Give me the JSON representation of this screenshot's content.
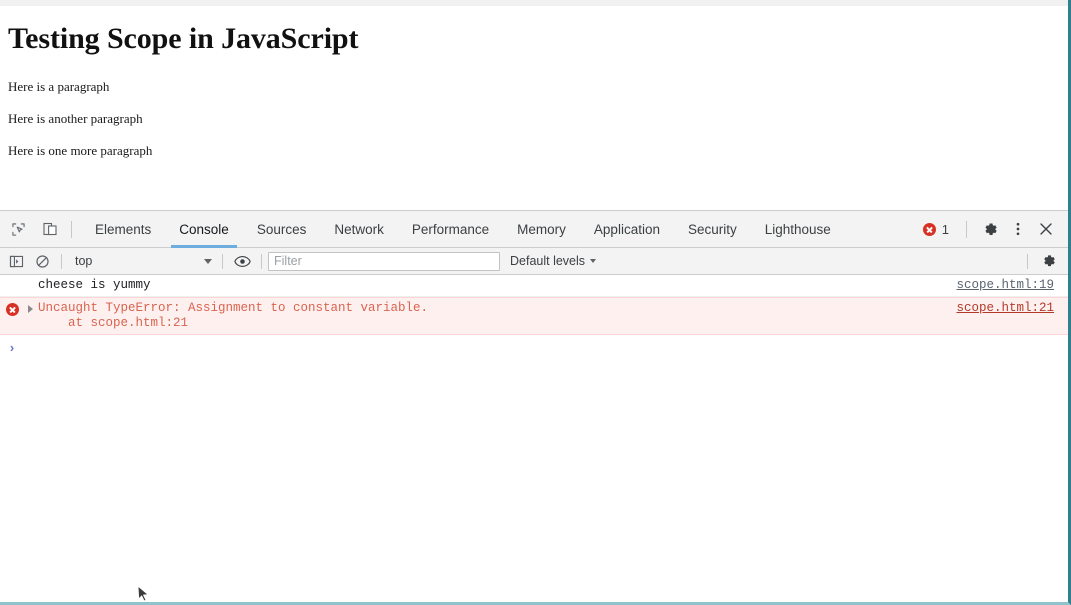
{
  "page": {
    "title": "Testing Scope in JavaScript",
    "paragraphs": [
      "Here is a paragraph",
      "Here is another paragraph",
      "Here is one more paragraph"
    ]
  },
  "devtools": {
    "inspect_icon": "inspect-element-icon",
    "device_icon": "device-toolbar-icon",
    "tabs": [
      {
        "label": "Elements",
        "active": false
      },
      {
        "label": "Console",
        "active": true
      },
      {
        "label": "Sources",
        "active": false
      },
      {
        "label": "Network",
        "active": false
      },
      {
        "label": "Performance",
        "active": false
      },
      {
        "label": "Memory",
        "active": false
      },
      {
        "label": "Application",
        "active": false
      },
      {
        "label": "Security",
        "active": false
      },
      {
        "label": "Lighthouse",
        "active": false
      }
    ],
    "error_badge": {
      "icon": "error-circle-icon",
      "count": "1"
    },
    "settings_icon": "gear-icon",
    "more_icon": "kebab-menu-icon",
    "close_icon": "close-icon",
    "accent_color": "#6cadde",
    "error_color": "#d93025"
  },
  "console": {
    "toolbar": {
      "sidebar_icon": "console-sidebar-icon",
      "clear_icon": "clear-console-icon",
      "context": "top",
      "eye_icon": "live-expression-eye-icon",
      "filter_placeholder": "Filter",
      "filter_value": "",
      "levels_label": "Default levels",
      "settings_icon": "console-settings-gear-icon"
    },
    "messages": [
      {
        "type": "log",
        "icon": "",
        "expandable": false,
        "text": "cheese is yummy",
        "source": "scope.html:19"
      },
      {
        "type": "error",
        "icon": "error-circle-icon",
        "expandable": true,
        "text": "Uncaught TypeError: Assignment to constant variable.\n    at scope.html:21",
        "source": "scope.html:21"
      }
    ],
    "prompt_caret": "›",
    "prompt_value": "",
    "error_row_bg": "#fff0f0",
    "error_text_color": "#d8644f"
  }
}
